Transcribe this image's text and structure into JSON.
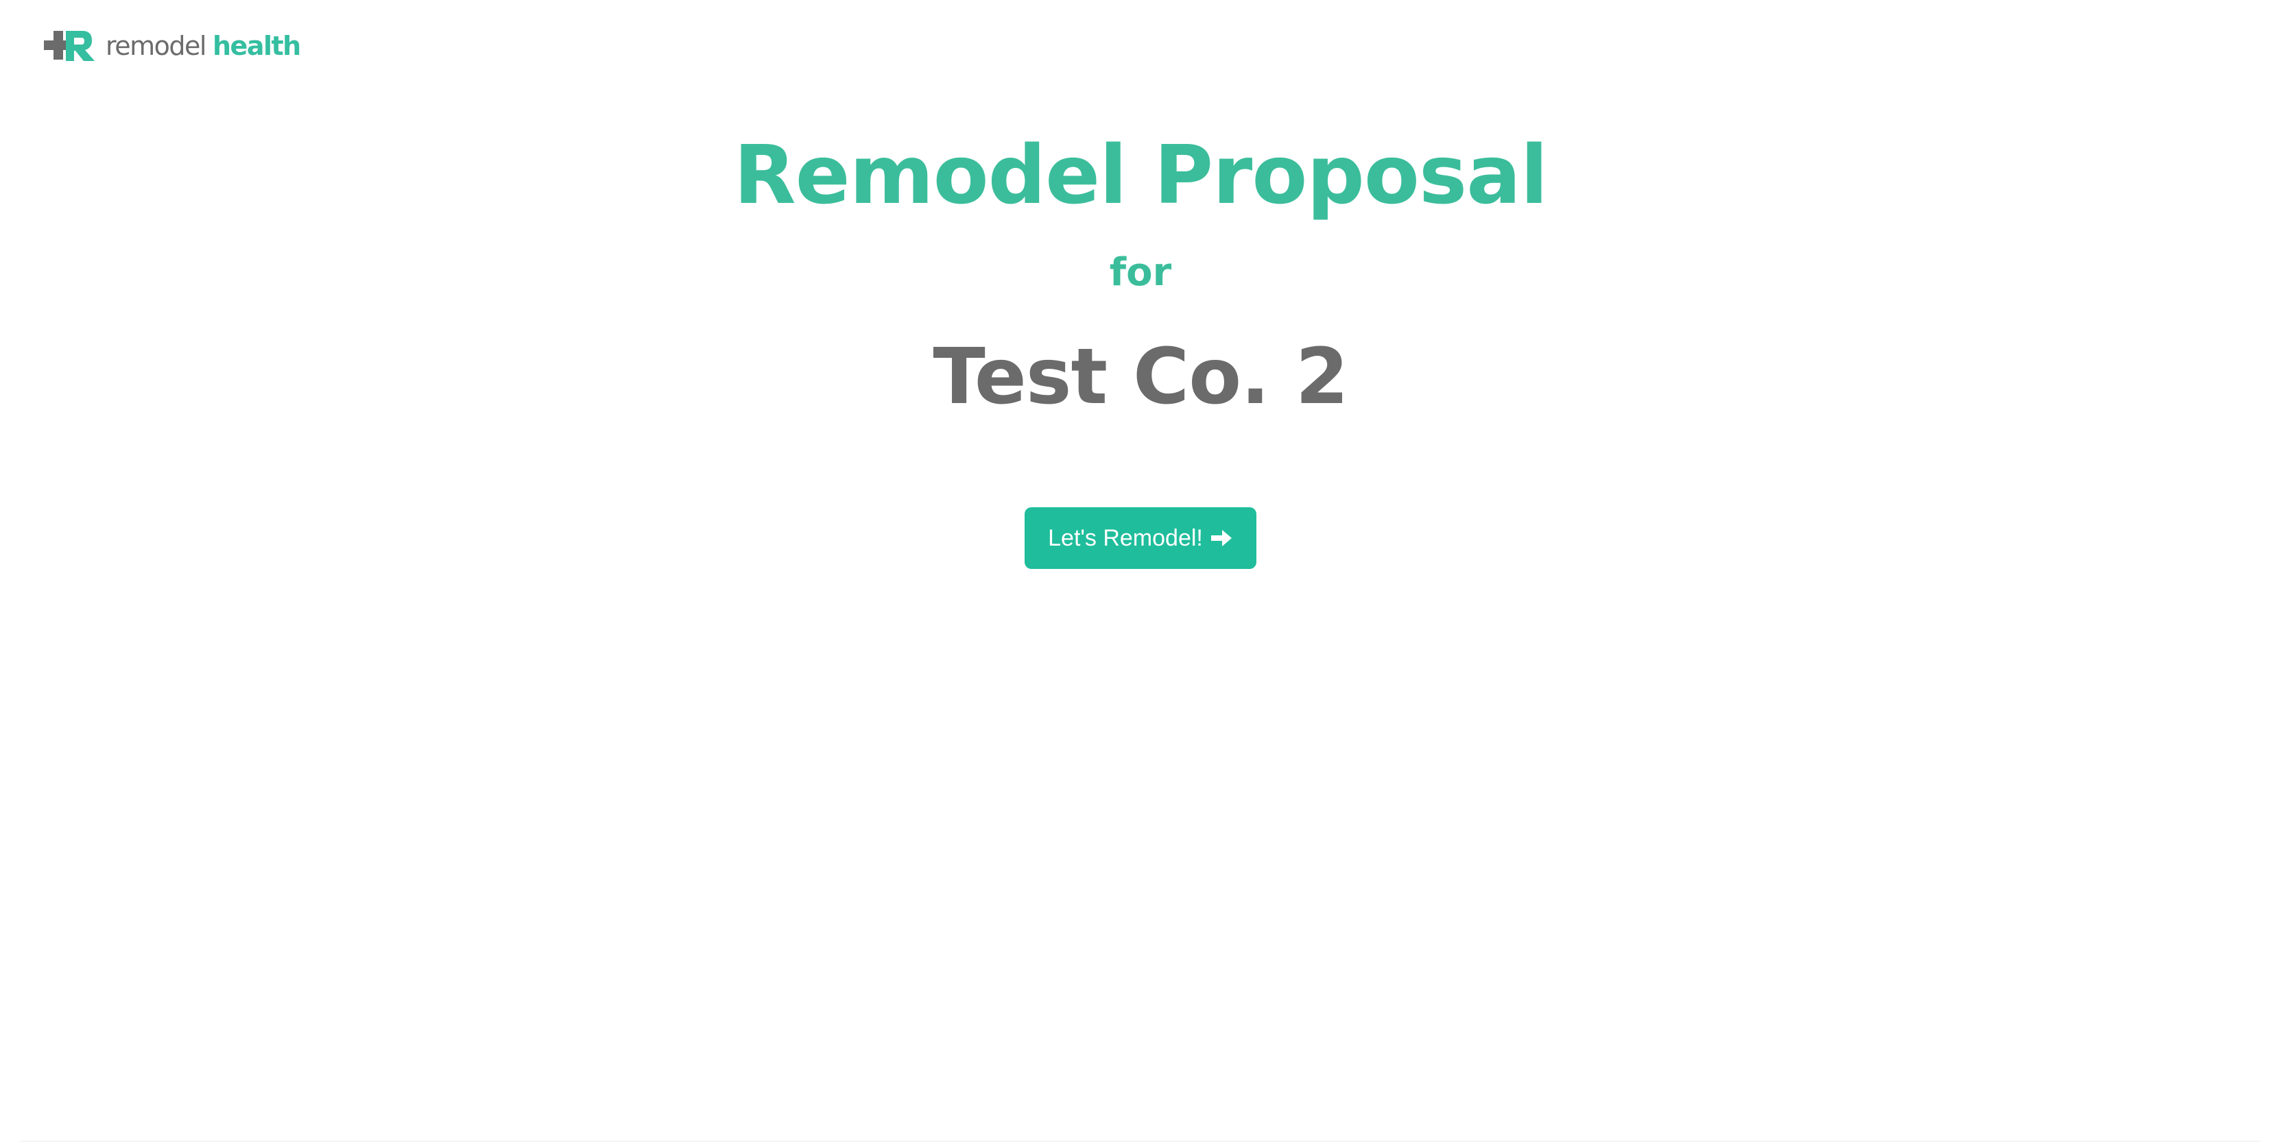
{
  "header": {
    "logo": {
      "word_primary": "remodel",
      "word_accent": "health",
      "mark_icon": "plus-r-logo-icon"
    }
  },
  "hero": {
    "title": "Remodel Proposal",
    "subtitle": "for",
    "company": "Test Co. 2",
    "cta": {
      "label": "Let's Remodel!",
      "icon": "arrow-right-icon"
    }
  },
  "colors": {
    "accent": "#3bbd9b",
    "button": "#1fbd9b",
    "text_gray": "#6b6b6b",
    "background": "#ffffff"
  }
}
